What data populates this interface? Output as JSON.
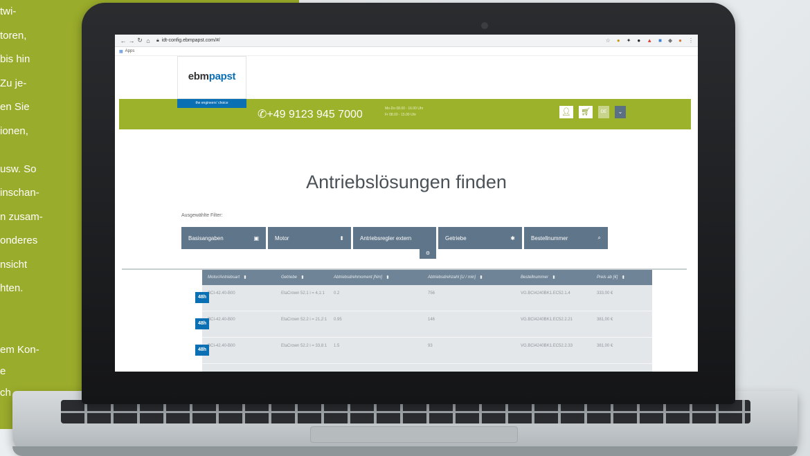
{
  "side_text": [
    "twi-",
    "toren,",
    "bis hin",
    "Zu je-",
    "en Sie",
    "ionen,",
    "usw. So",
    "inschan-",
    "n zusam-",
    "onderes",
    "nsicht",
    "hten.",
    "em Kon-",
    "e",
    "ch"
  ],
  "browser": {
    "url": "idt-config.ebmpapst.com/#/",
    "bookmarks_label": "Apps"
  },
  "site": {
    "logo_prefix": "ebm",
    "logo_brand": "papst",
    "tagline": "the engineers' choice",
    "phone": "+49 9123 945 7000",
    "hours_line1": "Mo-Do   08.00 - 16.00 Uhr",
    "hours_line2": "Fr   08.00 - 15.00 Uhr",
    "language": "DE"
  },
  "page_title": "Antriebslösungen finden",
  "filter_label": "Ausgewählte Filter:",
  "filters": [
    {
      "label": "Basisangaben",
      "icon": "document-icon"
    },
    {
      "label": "Motor",
      "icon": "sort-icon"
    },
    {
      "label": "Antriebsregler extern",
      "icon": "controller-icon"
    },
    {
      "label": "Getriebe",
      "icon": "gear-icon"
    },
    {
      "label": "Bestellnummer",
      "icon": "search-icon"
    }
  ],
  "table": {
    "headers": [
      "Motor/Antriebsart",
      "Getriebe",
      "Abtriebsdrehmoment [Nm]",
      "Abtriebsdrehzahl [U / min]",
      "Bestellnummer",
      "Preis ab [€]"
    ],
    "badge": "48h",
    "rows": [
      {
        "motor": "BCI-42.40-B00",
        "getriebe": "EtaCrown 52.1 i = 4,1:1",
        "moment": "0.2",
        "drehzahl": "756",
        "bestellnummer": "VG.BCI4240BK1.EC52.1.4",
        "preis": "333,00 €"
      },
      {
        "motor": "BCI-42.40-B00",
        "getriebe": "EtaCrown 52.2 i = 21,2:1",
        "moment": "0.95",
        "drehzahl": "146",
        "bestellnummer": "VG.BCI4240BK1.EC52.2.21",
        "preis": "381,00 €"
      },
      {
        "motor": "BCI-42.40-B00",
        "getriebe": "EtaCrown 52.2 i = 33,8:1",
        "moment": "1.5",
        "drehzahl": "93",
        "bestellnummer": "VG.BCI4240BK1.EC52.2.33",
        "preis": "381,00 €"
      }
    ]
  },
  "colors": {
    "green": "#9bb22a",
    "blue": "#0b6fb4",
    "slate": "#5f7589"
  }
}
